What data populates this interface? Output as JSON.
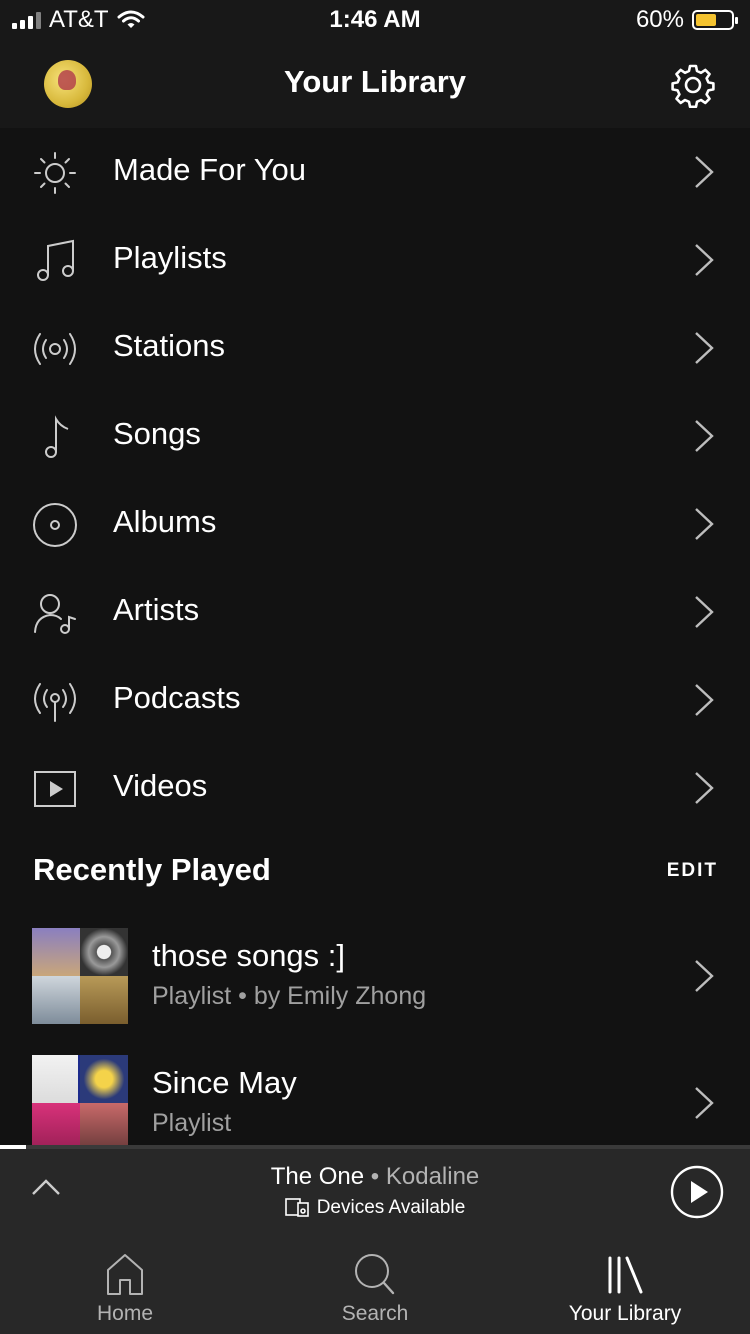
{
  "status_bar": {
    "carrier": "AT&T",
    "time": "1:46 AM",
    "battery_percent": "60%",
    "battery_level": 0.6,
    "battery_color": "#f5c431"
  },
  "header": {
    "title": "Your Library",
    "avatar_icon": "profile-avatar",
    "settings_icon": "gear-icon"
  },
  "menu": {
    "items": [
      {
        "label": "Made For You",
        "icon": "sun-icon"
      },
      {
        "label": "Playlists",
        "icon": "music-notes-icon"
      },
      {
        "label": "Stations",
        "icon": "radio-waves-icon"
      },
      {
        "label": "Songs",
        "icon": "music-note-icon"
      },
      {
        "label": "Albums",
        "icon": "disc-icon"
      },
      {
        "label": "Artists",
        "icon": "artist-icon"
      },
      {
        "label": "Podcasts",
        "icon": "podcast-icon"
      },
      {
        "label": "Videos",
        "icon": "video-play-icon"
      }
    ]
  },
  "recently_played": {
    "title": "Recently Played",
    "edit_label": "EDIT",
    "items": [
      {
        "title": "those songs :]",
        "subtitle": "Playlist • by Emily Zhong"
      },
      {
        "title": "Since May",
        "subtitle": "Playlist"
      }
    ]
  },
  "now_playing": {
    "track": "The One",
    "separator": " • ",
    "artist": "Kodaline",
    "devices_label": "Devices Available",
    "progress": 0.035
  },
  "tabs": [
    {
      "label": "Home",
      "icon": "home-icon",
      "active": false
    },
    {
      "label": "Search",
      "icon": "search-icon",
      "active": false
    },
    {
      "label": "Your Library",
      "icon": "library-icon",
      "active": true
    }
  ]
}
